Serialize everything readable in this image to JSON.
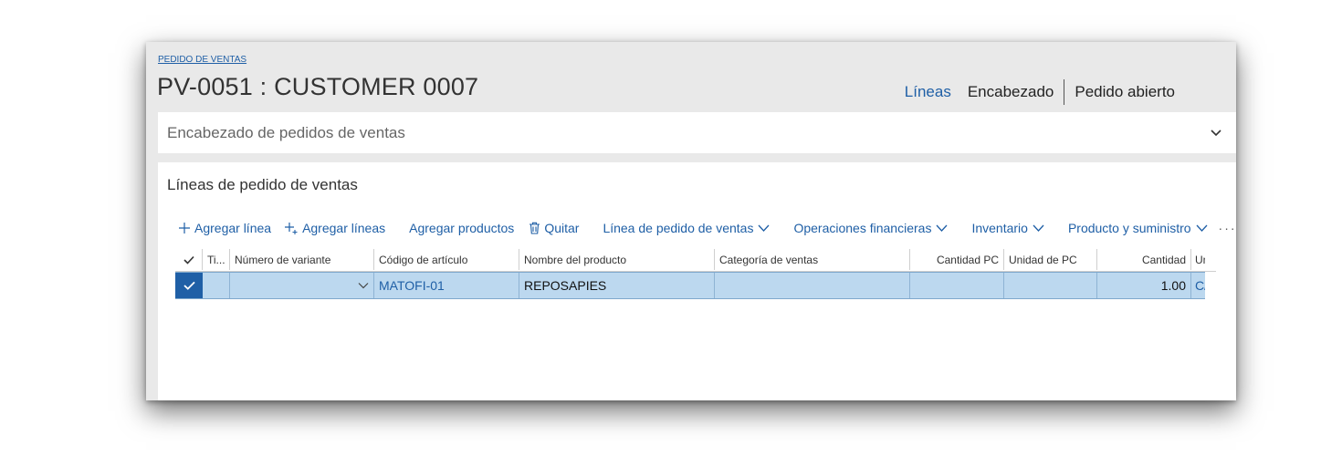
{
  "breadcrumb": "PEDIDO DE VENTAS",
  "page_title": "PV-0051 : CUSTOMER 0007",
  "tabs": [
    {
      "label": "Líneas",
      "active": true
    },
    {
      "label": "Encabezado",
      "active": false
    },
    {
      "label": "Pedido abierto",
      "active": false
    }
  ],
  "header_section": {
    "label": "Encabezado de pedidos de ventas",
    "icon": "chevron-down-icon"
  },
  "lines_section": {
    "title": "Líneas de pedido de ventas"
  },
  "toolbar": {
    "add_line": "Agregar línea",
    "add_lines": "Agregar líneas",
    "add_products": "Agregar productos",
    "remove": "Quitar",
    "sales_order_line": "Línea de pedido de ventas",
    "financials": "Operaciones financieras",
    "inventory": "Inventario",
    "product_supply": "Producto y suministro",
    "more": "···"
  },
  "grid": {
    "columns": {
      "type": "Ti...",
      "variant": "Número de variante",
      "item_code": "Código de artículo",
      "product_name": "Nombre del producto",
      "sales_category": "Categoría de ventas",
      "cw_qty": "Cantidad PC",
      "cw_unit": "Unidad de PC",
      "quantity": "Cantidad",
      "unit": "Unid"
    },
    "rows": [
      {
        "type": "",
        "variant": "",
        "item_code": "MATOFI-01",
        "product_name": "REPOSAPIES",
        "sales_category": "",
        "cw_qty": "",
        "cw_unit": "",
        "quantity": "1.00",
        "unit": "C/"
      }
    ]
  },
  "colors": {
    "accent": "#1f5fa6",
    "selected_row": "#bcd8ef",
    "window_bg": "#e9e9e9"
  }
}
